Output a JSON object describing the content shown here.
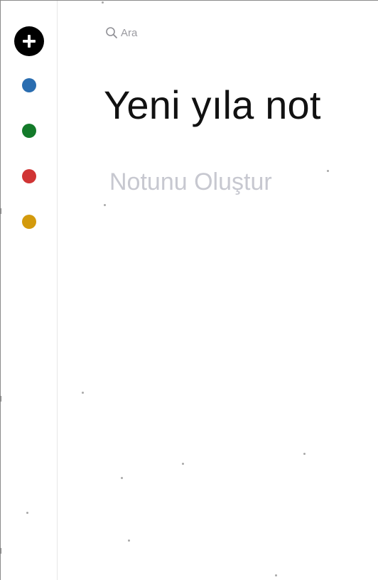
{
  "search": {
    "placeholder": "Ara"
  },
  "sidebar": {
    "add_button_icon": "plus-icon",
    "colors": [
      {
        "name": "blue",
        "hex": "#2a6db0"
      },
      {
        "name": "green",
        "hex": "#137a2a"
      },
      {
        "name": "red",
        "hex": "#d03434"
      },
      {
        "name": "yellow",
        "hex": "#d39a0c"
      }
    ]
  },
  "note": {
    "title": "Yeni yıla not",
    "body_placeholder": "Notunu Oluştur"
  }
}
